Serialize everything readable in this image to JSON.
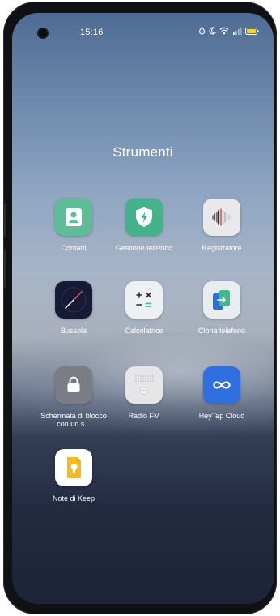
{
  "status_bar": {
    "time": "15:16"
  },
  "folder": {
    "title": "Strumenti"
  },
  "apps": {
    "contacts": {
      "label": "Contatti",
      "icon": "contacts-icon",
      "color": "#5ebc97"
    },
    "phone_manager": {
      "label": "Gestione telefono",
      "icon": "shield-lightning-icon",
      "color": "#43b38a"
    },
    "recorder": {
      "label": "Registratore",
      "icon": "waveform-icon",
      "color": "#e9e9ec"
    },
    "compass": {
      "label": "Bussola",
      "icon": "compass-icon",
      "color": "#161a35"
    },
    "calculator": {
      "label": "Calcolatrice",
      "icon": "calculator-icon",
      "color": "#eef0f2"
    },
    "clone_phone": {
      "label": "Clona telefono",
      "icon": "clone-phone-icon",
      "color": "#e8eef0"
    },
    "lock_screen": {
      "label": "Schermata di blocco con un s...",
      "icon": "lock-icon",
      "color": "#7a7d86"
    },
    "radio_fm": {
      "label": "Radio FM",
      "icon": "radio-icon",
      "color": "#e6e6e8"
    },
    "heytap_cloud": {
      "label": "HeyTap Cloud",
      "icon": "cloud-infinity-icon",
      "color": "#2f6fe0"
    },
    "keep_notes": {
      "label": "Note di Keep",
      "icon": "keep-bulb-icon",
      "color": "#f0c419"
    }
  }
}
